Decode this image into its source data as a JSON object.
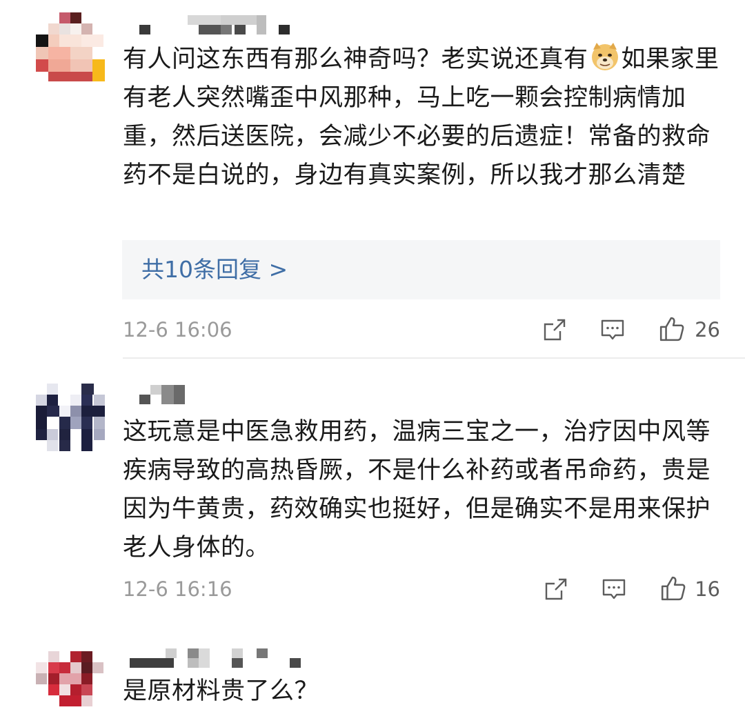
{
  "comments": [
    {
      "text_before_emoji": "有人问这东西有那么神奇吗？老实说还真有",
      "emoji": "doge-emoji",
      "text_after_emoji": "如果家里有老人突然嘴歪中风那种，马上吃一颗会控制病情加重，然后送医院，会减少不必要的后遗症！常备的救命药不是白说的，身边有真实案例，所以我才那么清楚",
      "replies_label": "共10条回复 >",
      "time": "12-6 16:06",
      "likes": "26"
    },
    {
      "text": "这玩意是中医急救用药，温病三宝之一，治疗因中风等疾病导致的高热昏厥，不是什么补药或者吊命药，贵是因为牛黄贵，药效确实也挺好，但是确实不是用来保护老人身体的。",
      "time": "12-6 16:16",
      "likes": "16"
    },
    {
      "text": "是原材料贵了么？"
    }
  ],
  "icons": {
    "share": "share-icon",
    "comment": "comment-icon",
    "like": "thumbs-up-icon"
  },
  "colors": {
    "reply_link": "#3f6ea6",
    "reply_box": "#f5f6f7",
    "meta_text": "#9a9a9a"
  }
}
